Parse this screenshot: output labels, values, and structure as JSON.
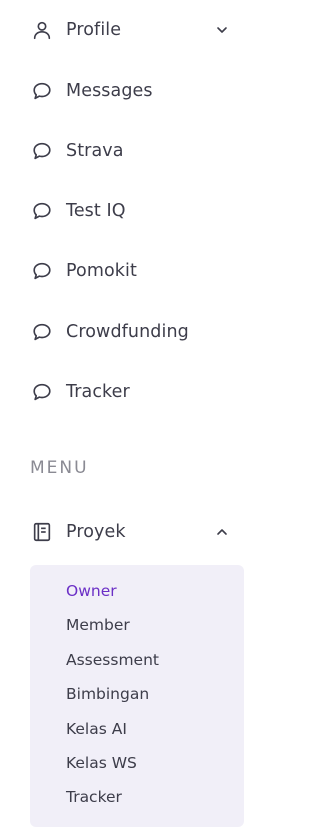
{
  "nav": {
    "items": [
      {
        "label": "Profile",
        "icon": "user-icon",
        "has_chevron": true,
        "chevron": "chevron-down-icon"
      },
      {
        "label": "Messages",
        "icon": "chat-icon"
      },
      {
        "label": "Strava",
        "icon": "chat-icon"
      },
      {
        "label": "Test IQ",
        "icon": "chat-icon"
      },
      {
        "label": "Pomokit",
        "icon": "chat-icon"
      },
      {
        "label": "Crowdfunding",
        "icon": "chat-icon"
      },
      {
        "label": "Tracker",
        "icon": "chat-icon"
      }
    ],
    "section_title": "MENU",
    "proyek": {
      "label": "Proyek",
      "icon": "document-icon",
      "chevron": "chevron-up-icon",
      "expanded": true,
      "sub_items": [
        {
          "label": "Owner",
          "active": true
        },
        {
          "label": "Member"
        },
        {
          "label": "Assessment"
        },
        {
          "label": "Bimbingan"
        },
        {
          "label": "Kelas AI"
        },
        {
          "label": "Kelas WS"
        },
        {
          "label": "Tracker"
        }
      ]
    }
  },
  "colors": {
    "text": "#3d3d4a",
    "muted": "#8a8a93",
    "accent": "#6b2fc6",
    "submenu_bg": "#f1eff8"
  }
}
